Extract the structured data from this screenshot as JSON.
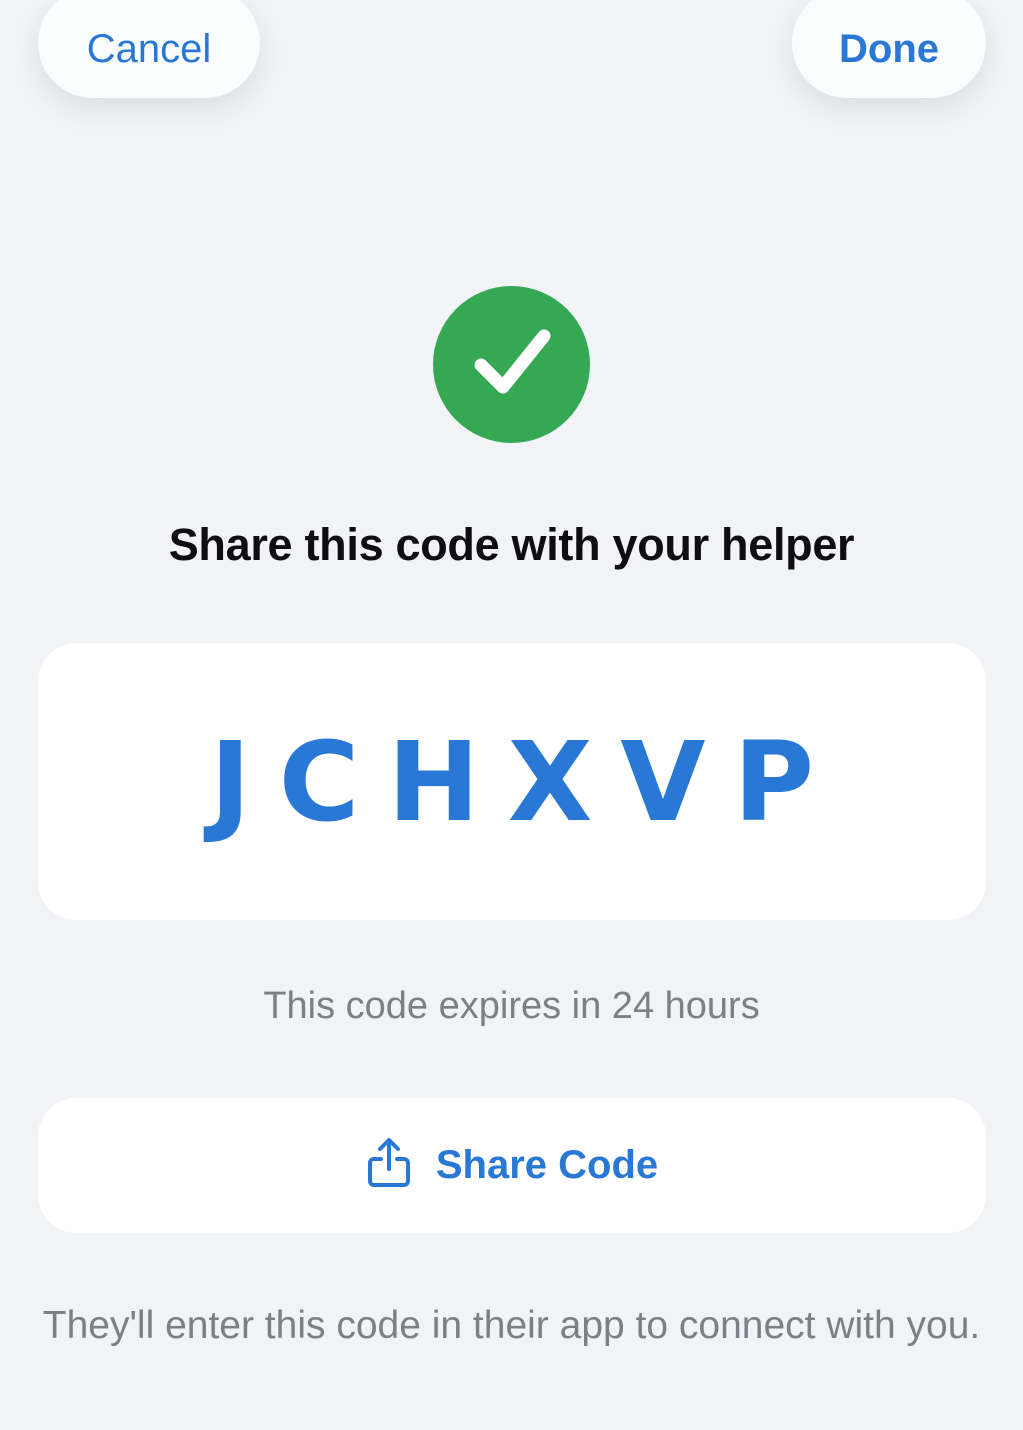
{
  "nav": {
    "cancel_label": "Cancel",
    "done_label": "Done"
  },
  "status_icon": "checkmark-circle-icon",
  "title": "Share this code with your helper",
  "code": {
    "value": "JCHXVP"
  },
  "expires_text": "This code expires in 24 hours",
  "share_button": {
    "icon": "share-icon",
    "label": "Share Code"
  },
  "footer_text": "They'll enter this code in their app to connect with you.",
  "colors": {
    "accent": "#2a78d6",
    "success": "#34a853",
    "background": "#f2f3f7",
    "secondary_text": "#7d7f86"
  }
}
